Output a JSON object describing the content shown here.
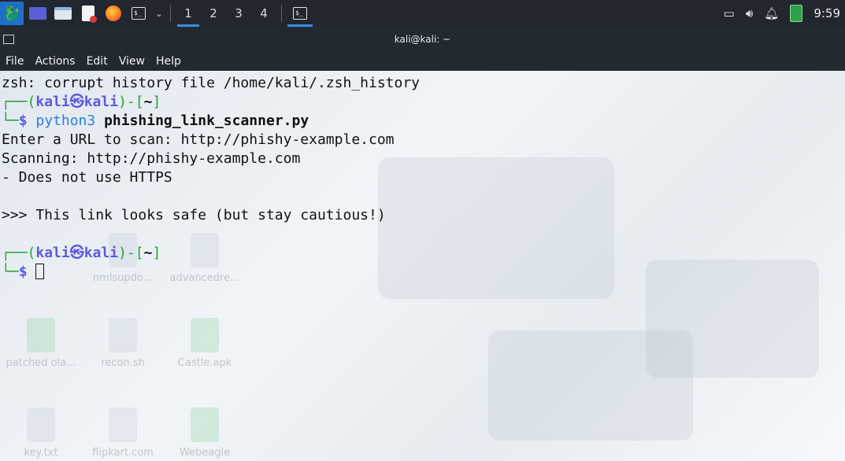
{
  "topbar": {
    "workspaces": [
      "1",
      "2",
      "3",
      "4"
    ],
    "active_workspace": "1",
    "clock": "9:59",
    "icons": [
      "kali-menu-icon",
      "desktop-icon",
      "file-manager-icon",
      "text-editor-icon",
      "firefox-icon",
      "terminal-icon",
      "chevron-down-icon",
      "network-icon",
      "volume-icon",
      "bell-icon",
      "battery-icon"
    ]
  },
  "window": {
    "title": "kali@kali: ~",
    "menu": [
      "File",
      "Actions",
      "Edit",
      "View",
      "Help"
    ]
  },
  "terminal": {
    "line1": "zsh: corrupt history file /home/kali/.zsh_history",
    "prompt_user": "kali",
    "prompt_symbol": "㉿",
    "prompt_host": "kali",
    "prompt_dir": "~",
    "command_bin": "python3",
    "command_arg": "phishing_link_scanner.py",
    "out1": "Enter a URL to scan: http://phishy-example.com",
    "out2": "Scanning: http://phishy-example.com",
    "out3": "- Does not use HTTPS",
    "out4": ">>> This link looks safe (but stay cautious!)"
  },
  "desktop_icons": [
    "nmlsupdo...",
    "advancedre...",
    "patched ola...",
    "recon.sh",
    "Castle.apk",
    "key.txt",
    "flipkart.com",
    "Webeagle"
  ]
}
